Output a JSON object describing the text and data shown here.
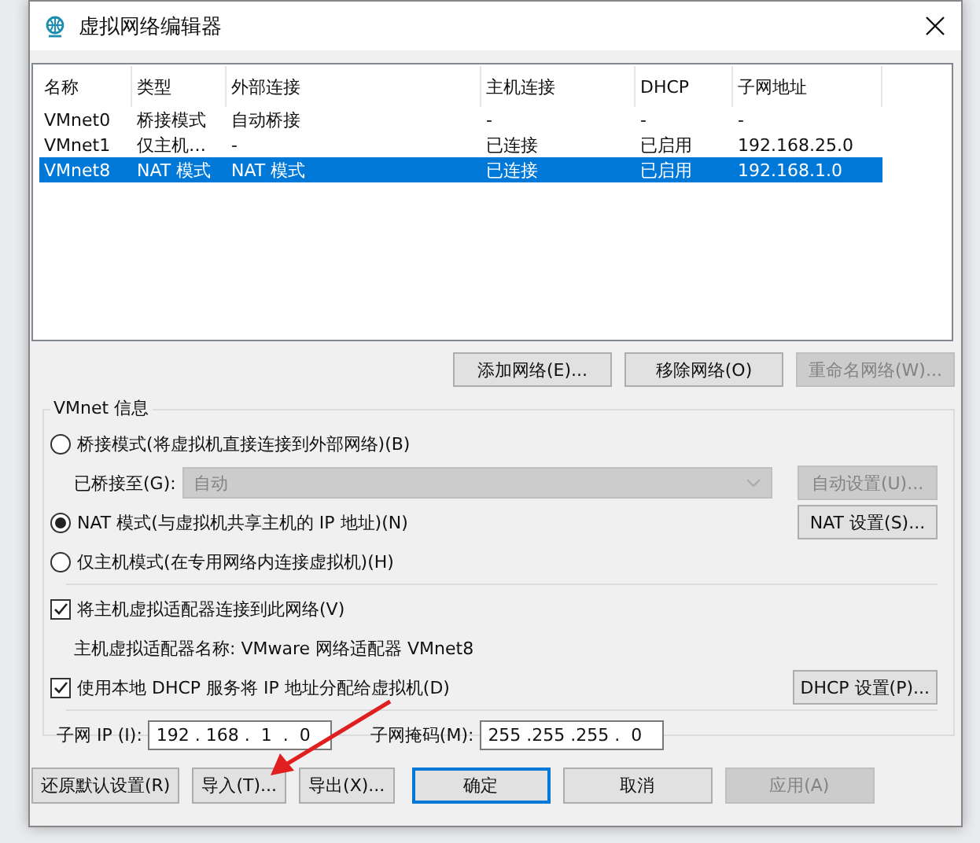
{
  "window": {
    "title": "虚拟网络编辑器"
  },
  "table": {
    "columns": [
      "名称",
      "类型",
      "外部连接",
      "主机连接",
      "DHCP",
      "子网地址"
    ],
    "rows": [
      {
        "cells": [
          "VMnet0",
          "桥接模式",
          "自动桥接",
          "-",
          "-",
          "-"
        ],
        "selected": false
      },
      {
        "cells": [
          "VMnet1",
          "仅主机…",
          "-",
          "已连接",
          "已启用",
          "192.168.25.0"
        ],
        "selected": false
      },
      {
        "cells": [
          "VMnet8",
          "NAT 模式",
          "NAT 模式",
          "已连接",
          "已启用",
          "192.168.1.0"
        ],
        "selected": true
      }
    ]
  },
  "network_buttons": [
    {
      "label": "添加网络(E)...",
      "disabled": false
    },
    {
      "label": "移除网络(O)",
      "disabled": false
    },
    {
      "label": "重命名网络(W)...",
      "disabled": true
    }
  ],
  "vmnet_info": {
    "title": "VMnet 信息",
    "bridge_mode": {
      "label": "桥接模式(将虚拟机直接连接到外部网络)(B)",
      "selected": false
    },
    "bridged_to": {
      "label": "已桥接至(G):",
      "value": "自动",
      "disabled": true
    },
    "auto_settings_button": {
      "label": "自动设置(U)...",
      "disabled": true
    },
    "nat_mode": {
      "label": "NAT 模式(与虚拟机共享主机的 IP 地址)(N)",
      "selected": true
    },
    "nat_settings_button": {
      "label": "NAT 设置(S)...",
      "disabled": false
    },
    "host_only_mode": {
      "label": "仅主机模式(在专用网络内连接虚拟机)(H)",
      "selected": false
    },
    "connect_adapter": {
      "label": "将主机虚拟适配器连接到此网络(V)",
      "checked": true
    },
    "adapter_name": "主机虚拟适配器名称: VMware 网络适配器 VMnet8",
    "use_dhcp": {
      "label": "使用本地 DHCP 服务将 IP 地址分配给虚拟机(D)",
      "checked": true
    },
    "dhcp_settings_button": {
      "label": "DHCP 设置(P)...",
      "disabled": false
    },
    "subnet_ip": {
      "label": "子网 IP (I):",
      "value": "192 . 168 .  1  .  0"
    },
    "subnet_mask": {
      "label": "子网掩码(M):",
      "value": "255 .255 .255 .  0"
    }
  },
  "bottom_buttons": [
    {
      "label": "还原默认设置(R)",
      "default": false,
      "disabled": false
    },
    {
      "label": "导入(T)...",
      "default": false,
      "disabled": false
    },
    {
      "label": "导出(X)...",
      "default": false,
      "disabled": false
    },
    {
      "label": "确定",
      "default": true,
      "disabled": false
    },
    {
      "label": "取消",
      "default": false,
      "disabled": false
    },
    {
      "label": "应用(A)",
      "default": false,
      "disabled": true
    }
  ]
}
